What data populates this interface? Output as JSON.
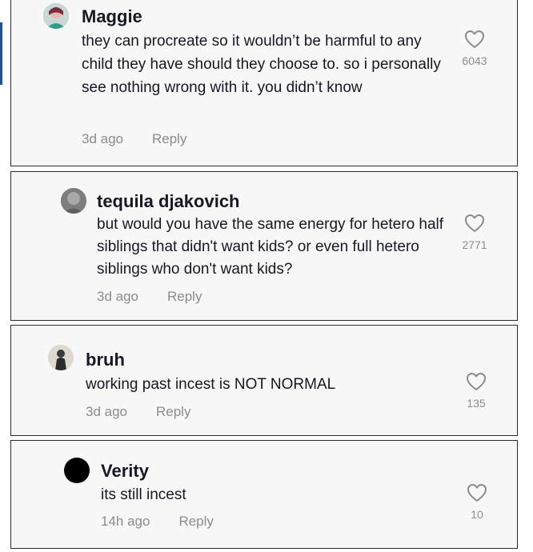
{
  "comments": [
    {
      "username": "Maggie",
      "text": "they can procreate so it wouldn’t be harmful to any child they have should they choose to. so i personally see nothing wrong with it. you didn’t know",
      "time": "3d ago",
      "reply_label": "Reply",
      "likes": "6043",
      "avatar_color": "#2a9d8f",
      "avatar_icon": "user-avatar"
    },
    {
      "username": "tequila djakovich",
      "text": "but would you have the same energy for hetero half siblings that didn't want kids? or even full hetero siblings who don't want kids?",
      "time": "3d ago",
      "reply_label": "Reply",
      "likes": "2771",
      "avatar_color": "#8c8c8c",
      "avatar_icon": "user-avatar"
    },
    {
      "username": "bruh",
      "text": "working past incest is NOT NORMAL",
      "time": "3d ago",
      "reply_label": "Reply",
      "likes": "135",
      "avatar_color": "#d9d5cf",
      "avatar_icon": "user-avatar"
    },
    {
      "username": "Verity",
      "text": "its still incest",
      "time": "14h ago",
      "reply_label": "Reply",
      "likes": "10",
      "avatar_color": "#000000",
      "avatar_icon": "user-avatar"
    }
  ],
  "icons": {
    "like": "heart-outline-icon"
  },
  "colors": {
    "text": "#161823",
    "muted": "#8a8b91",
    "card_bg": "#f7f7f8",
    "border": "#2b2b2b"
  }
}
